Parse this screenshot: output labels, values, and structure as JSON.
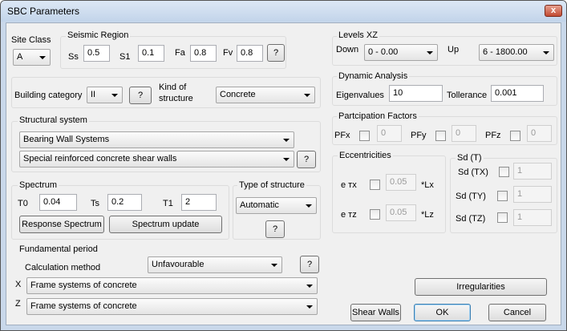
{
  "window": {
    "title": "SBC Parameters",
    "close_label": "x"
  },
  "site_class": {
    "label": "Site Class",
    "value": "A"
  },
  "seismic": {
    "title": "Seismic Region",
    "ss_label": "Ss",
    "ss": "0.5",
    "s1_label": "S1",
    "s1": "0.1",
    "fa_label": "Fa",
    "fa": "0.8",
    "fv_label": "Fv",
    "fv": "0.8",
    "help": "?"
  },
  "building": {
    "label": "Building category",
    "category": "II",
    "help": "?",
    "kind_label_1": "Kind of",
    "kind_label_2": "structure",
    "kind": "Concrete"
  },
  "structural": {
    "title": "Structural system",
    "system": "Bearing Wall Systems",
    "subsystem": "Special reinforced concrete shear walls",
    "help": "?"
  },
  "spectrum": {
    "title": "Spectrum",
    "t0_label": "T0",
    "t0": "0.04",
    "ts_label": "Ts",
    "ts": "0.2",
    "t1_label": "T1",
    "t1": "2",
    "response_btn": "Response Spectrum",
    "update_btn": "Spectrum update"
  },
  "type_structure": {
    "title": "Type of structure",
    "value": "Automatic",
    "help": "?"
  },
  "fundamental": {
    "title": "Fundamental period",
    "calc_label": "Calculation method",
    "calc": "Unfavourable",
    "help": "?",
    "x_label": "X",
    "x": "Frame systems of concrete",
    "z_label": "Z",
    "z": "Frame systems of concrete"
  },
  "levels": {
    "title": "Levels XZ",
    "down_label": "Down",
    "down": "0 - 0.00",
    "up_label": "Up",
    "up": "6 - 1800.00"
  },
  "dynamic": {
    "title": "Dynamic Analysis",
    "eig_label": "Eigenvalues",
    "eig": "10",
    "tol_label": "Tollerance",
    "tol": "0.001"
  },
  "participation": {
    "title": "Partcipation Factors",
    "pfx_label": "PFx",
    "pfx": "0",
    "pfy_label": "PFy",
    "pfy": "0",
    "pfz_label": "PFz",
    "pfz": "0"
  },
  "ecc": {
    "title": "Eccentricities",
    "ex_label": "e тx",
    "ex": "0.05",
    "ex_unit": "*Lx",
    "ez_label": "e тz",
    "ez": "0.05",
    "ez_unit": "*Lz"
  },
  "sd": {
    "title": "Sd (T)",
    "tx_label": "Sd (TX)",
    "tx": "1",
    "ty_label": "Sd (TY)",
    "ty": "1",
    "tz_label": "Sd (TZ)",
    "tz": "1"
  },
  "actions": {
    "irregularities": "Irregularities",
    "shear_walls": "Shear Walls",
    "ok": "OK",
    "cancel": "Cancel"
  }
}
